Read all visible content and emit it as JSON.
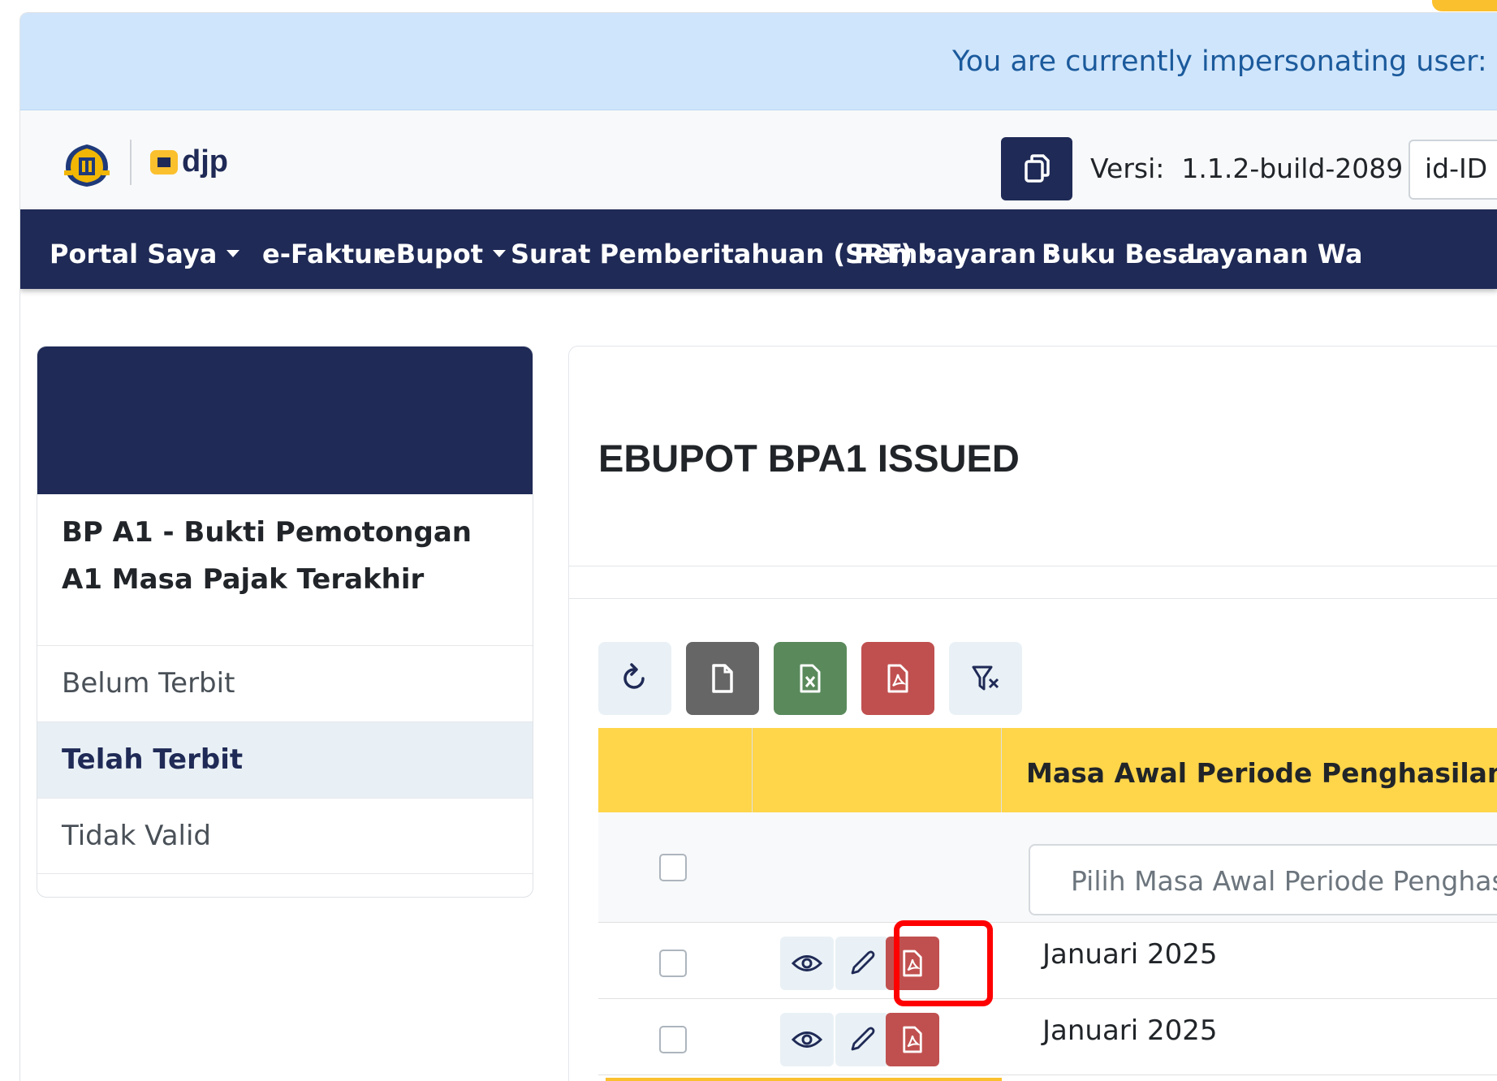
{
  "banner": {
    "text": "You are currently impersonating user: - "
  },
  "header": {
    "logo_text": "djp",
    "version_label": "Versi:",
    "version_value": "1.1.2-build-2089",
    "language": "id-ID"
  },
  "nav": {
    "items": [
      {
        "label": "Portal Saya",
        "dropdown": true
      },
      {
        "label": "e-Faktur",
        "dropdown": false
      },
      {
        "label": "eBupot",
        "dropdown": true
      },
      {
        "label": "Surat Pemberitahuan (SPT)",
        "dropdown": true
      },
      {
        "label": "Pembayaran",
        "dropdown": true
      },
      {
        "label": "Buku Besar",
        "dropdown": false
      },
      {
        "label": "Layanan Wa",
        "dropdown": false
      }
    ]
  },
  "sidebar": {
    "title": "BP A1 - Bukti Pemotongan A1 Masa Pajak Terakhir",
    "items": [
      {
        "label": "Belum Terbit",
        "active": false
      },
      {
        "label": "Telah Terbit",
        "active": true
      },
      {
        "label": "Tidak Valid",
        "active": false
      }
    ]
  },
  "main": {
    "title": "EBUPOT BPA1 ISSUED",
    "toolbar": [
      {
        "name": "refresh-button",
        "icon": "refresh-icon"
      },
      {
        "name": "export-file-button",
        "icon": "file-icon"
      },
      {
        "name": "export-excel-button",
        "icon": "excel-file-icon"
      },
      {
        "name": "export-pdf-button",
        "icon": "pdf-file-icon"
      },
      {
        "name": "clear-filter-button",
        "icon": "filter-clear-icon"
      }
    ],
    "table": {
      "columns": [
        "",
        "",
        "Masa Awal Periode Penghasilan"
      ],
      "filter_placeholder": "Pilih Masa Awal Periode Penghasilan",
      "rows": [
        {
          "masa_awal": "Januari 2025"
        },
        {
          "masa_awal": "Januari 2025"
        }
      ]
    }
  },
  "colors": {
    "navy": "#1f2a56",
    "banner_bg": "#cfe5fb",
    "banner_text": "#1b5a9c",
    "table_header": "#ffd54a",
    "excel_green": "#5a8a5c",
    "pdf_red": "#c0504f",
    "gray_btn": "#666666",
    "highlight": "#ff0000"
  }
}
